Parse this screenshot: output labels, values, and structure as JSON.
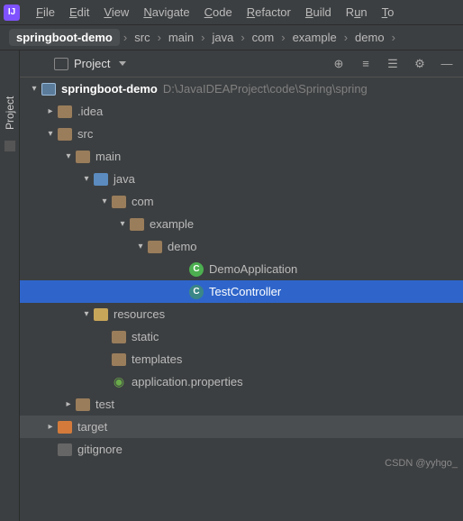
{
  "menu": {
    "file": "File",
    "edit": "Edit",
    "view": "View",
    "navigate": "Navigate",
    "code": "Code",
    "refactor": "Refactor",
    "build": "Build",
    "run": "Run",
    "tools": "Too"
  },
  "breadcrumb": {
    "root": "springboot-demo",
    "p1": "src",
    "p2": "main",
    "p3": "java",
    "p4": "com",
    "p5": "example",
    "p6": "demo"
  },
  "sidetab": {
    "project": "Project"
  },
  "toolbar": {
    "project": "Project"
  },
  "tree": {
    "root": "springboot-demo",
    "root_path": "D:\\JavaIDEAProject\\code\\Spring\\spring",
    "idea": ".idea",
    "src": "src",
    "main": "main",
    "java": "java",
    "com": "com",
    "example": "example",
    "demo": "demo",
    "demoApp": "DemoApplication",
    "testCtrl": "TestController",
    "resources": "resources",
    "static": "static",
    "templates": "templates",
    "appProps": "application.properties",
    "test": "test",
    "target": "target",
    "gitignore": "gitignore"
  },
  "watermark": "CSDN @yyhgo_"
}
